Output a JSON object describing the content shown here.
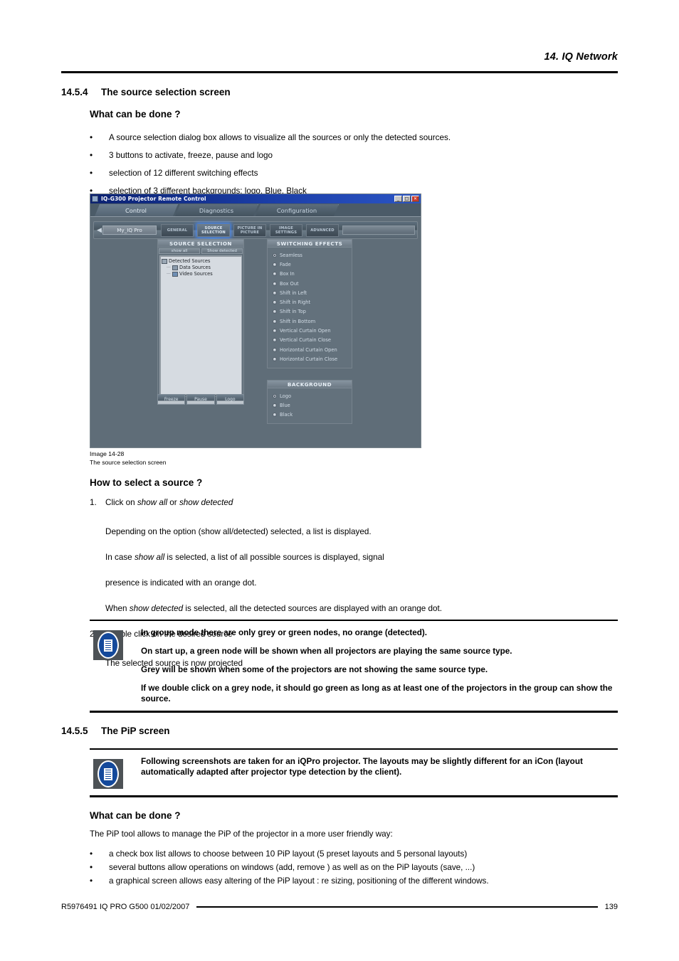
{
  "header": {
    "chapter": "14.  IQ Network"
  },
  "sections": {
    "s1": {
      "number": "14.5.4",
      "title": "The source selection screen"
    },
    "s1_sub1": "What can be done ?",
    "s1_bullets": [
      "A source selection dialog box allows to visualize all the sources or only the detected sources.",
      "3 buttons to activate, freeze, pause and logo",
      "selection of 12 different switching effects",
      "selection of 3 different backgrounds:  logo, Blue, Black"
    ],
    "s1_sub2": "How to select a source ?",
    "steps": [
      {
        "n": "1.",
        "text_html": "Click on <em>show all</em> or <em>show detected</em>",
        "lines_html": [
          "Depending on the option (show all/detected) selected, a list is displayed.",
          "In case <em>show all</em> is selected, a list of all possible sources is displayed, signal",
          "presence is indicated with an orange dot.",
          "When <em>show detected</em> is selected, all the detected sources are displayed with an orange dot."
        ]
      },
      {
        "n": "2.",
        "text_html": "Double click on the desired source",
        "lines_html": [
          "The selected source is now projected"
        ]
      }
    ],
    "note1": [
      "In group mode there are only grey or green nodes, no orange (detected).",
      "On start up, a green node will be shown when all projectors are playing the same source type.",
      "Grey will be shown when some of the projectors are not showing the same source type.",
      "If we double click on a grey node, it should go green as long as at least one of the projectors in the group can show the source."
    ],
    "s2": {
      "number": "14.5.5",
      "title": "The PiP screen"
    },
    "note2": [
      "Following screenshots are taken for an iQPro projector.  The layouts may be slightly different for an iCon (layout automatically adapted after projector type detection by the client)."
    ],
    "s2_sub1": "What can be done ?",
    "s2_intro": "The PiP tool allows to manage the PiP of the projector in a more user friendly way:",
    "s2_bullets": [
      "a check box list allows to choose between 10 PiP layout (5 preset layouts and 5 personal layouts)",
      "several buttons allow operations on windows (add, remove ) as well as on the PiP layouts (save, ...)",
      "a graphical screen allows easy altering of the PiP layout :  re sizing, positioning of the different windows."
    ]
  },
  "figure": {
    "caption_id": "Image 14-28",
    "caption_text": "The source selection screen",
    "window": {
      "title": "IQ-G300 Projector Remote Control",
      "buttons": {
        "minimize": "_",
        "maximize": "□",
        "close": "✕"
      },
      "tabs": [
        {
          "label": "Control",
          "active": true
        },
        {
          "label": "Diagnostics",
          "active": false
        },
        {
          "label": "Configuration",
          "active": false
        }
      ],
      "toolbar": {
        "back_arrow": "◀",
        "projector_name": "My_IQ Pro",
        "buttons": [
          {
            "line1": "GENERAL",
            "line2": "",
            "active": false
          },
          {
            "line1": "SOURCE",
            "line2": "SELECTION",
            "active": true
          },
          {
            "line1": "PICTURE IN",
            "line2": "PICTURE",
            "active": false
          },
          {
            "line1": "IMAGE",
            "line2": "SETTINGS",
            "active": false
          },
          {
            "line1": "ADVANCED",
            "line2": "",
            "active": false
          }
        ]
      },
      "source_panel": {
        "title": "SOURCE SELECTION",
        "tabs": [
          "show all",
          "Show detected"
        ],
        "tree": [
          {
            "label": "Detected Sources",
            "level": 0,
            "icon": "network-icon",
            "twisty": ""
          },
          {
            "label": "Data Sources",
            "level": 1,
            "icon": "monitor-icon",
            "twisty": "···"
          },
          {
            "label": "Video Sources",
            "level": 1,
            "icon": "video-icon",
            "twisty": "···"
          }
        ],
        "actions": [
          "Freeze",
          "Pause",
          "Logo"
        ]
      },
      "effects_panel": {
        "title": "SWITCHING EFFECTS",
        "options": [
          {
            "label": "Seamless",
            "selected": true
          },
          {
            "label": "Fade",
            "selected": false
          },
          {
            "label": "Box In",
            "selected": false
          },
          {
            "label": "Box Out",
            "selected": false
          },
          {
            "label": "Shift in Left",
            "selected": false
          },
          {
            "label": "Shift in Right",
            "selected": false
          },
          {
            "label": "Shift in Top",
            "selected": false
          },
          {
            "label": "Shift in Bottom",
            "selected": false
          },
          {
            "label": "Vertical Curtain Open",
            "selected": false
          },
          {
            "label": "Vertical Curtain Close",
            "selected": false
          },
          {
            "label": "Horizontal Curtain Open",
            "selected": false
          },
          {
            "label": "Horizontal Curtain Close",
            "selected": false
          }
        ]
      },
      "background_panel": {
        "title": "BACKGROUND",
        "options": [
          {
            "label": "Logo",
            "selected": true
          },
          {
            "label": "Blue",
            "selected": false
          },
          {
            "label": "Black",
            "selected": false
          }
        ]
      }
    }
  },
  "footer": {
    "left": "R5976491  IQ PRO G500  01/02/2007",
    "page": "139"
  },
  "colors": {
    "titlebar_blue": "#1b3ea8",
    "app_bg": "#63717c",
    "panel_header": "#8794a0",
    "tree_bg": "#d6dbe1",
    "note_icon_blue": "#14499b",
    "note_icon_frame": "#4d5256",
    "accent_glow": "#468cff"
  }
}
